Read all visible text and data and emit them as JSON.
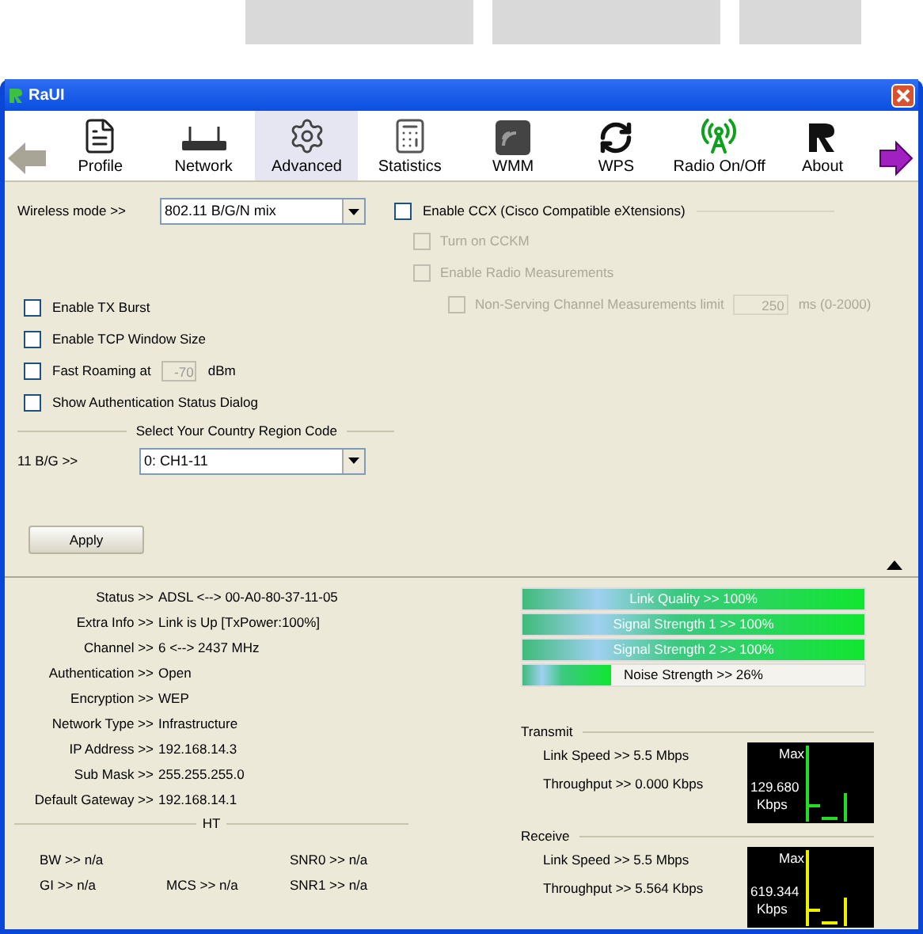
{
  "window": {
    "title": "RaUI"
  },
  "toolbar": [
    {
      "kind": "back",
      "selected": false
    },
    {
      "kind": "profile",
      "label": "Profile",
      "selected": false
    },
    {
      "kind": "network",
      "label": "Network",
      "selected": false
    },
    {
      "kind": "advanced",
      "label": "Advanced",
      "selected": true
    },
    {
      "kind": "statistics",
      "label": "Statistics",
      "selected": false
    },
    {
      "kind": "wmm",
      "label": "WMM",
      "selected": false
    },
    {
      "kind": "wps",
      "label": "WPS",
      "selected": false
    },
    {
      "kind": "radio",
      "label": "Radio On/Off",
      "selected": false
    },
    {
      "kind": "about",
      "label": "About",
      "selected": false
    },
    {
      "kind": "forward",
      "selected": false
    }
  ],
  "wireless_mode": {
    "label": "Wireless mode >>",
    "value": "802.11 B/G/N mix"
  },
  "ccx": {
    "label": "Enable CCX (Cisco Compatible eXtensions)",
    "checked": false
  },
  "ccx_options": [
    {
      "label": "Turn on CCKM",
      "checked": false,
      "disabled": true
    },
    {
      "label": "Enable Radio Measurements",
      "checked": false,
      "disabled": true
    }
  ],
  "non_serving": {
    "label": "Non-Serving Channel Measurements limit",
    "value": "250",
    "unit": "ms (0-2000)",
    "checked": false,
    "disabled": true
  },
  "options": [
    {
      "kind": "check",
      "label": "Enable TX Burst",
      "checked": false
    },
    {
      "kind": "check",
      "label": "Enable TCP Window Size",
      "checked": false
    },
    {
      "kind": "roaming",
      "label": "Fast Roaming at",
      "value": "-70",
      "unit": "dBm",
      "checked": false
    },
    {
      "kind": "check",
      "label": "Show Authentication Status Dialog",
      "checked": false
    }
  ],
  "region": {
    "title": "Select Your Country Region Code",
    "label": "11 B/G >>",
    "value": "0: CH1-11"
  },
  "apply": "Apply",
  "status": [
    {
      "label": "Status >>",
      "value": "ADSL <--> 00-A0-80-37-11-05"
    },
    {
      "label": "Extra Info >>",
      "value": "Link is Up [TxPower:100%]"
    },
    {
      "label": "Channel >>",
      "value": "6 <--> 2437 MHz"
    },
    {
      "label": "Authentication >>",
      "value": "Open"
    },
    {
      "label": "Encryption >>",
      "value": "WEP"
    },
    {
      "label": "Network Type >>",
      "value": "Infrastructure"
    },
    {
      "label": "IP Address >>",
      "value": "192.168.14.3"
    },
    {
      "label": "Sub Mask >>",
      "value": "255.255.255.0"
    },
    {
      "label": "Default Gateway >>",
      "value": "192.168.14.1"
    }
  ],
  "ht": {
    "title": "HT",
    "rows": [
      {
        "left": "BW >> n/a",
        "right": "SNR0 >> n/a"
      },
      {
        "left": "GI >> n/a",
        "middle": "MCS >> n/a",
        "right": "SNR1 >> n/a"
      }
    ]
  },
  "meters": [
    {
      "label": "Link Quality >> 100%",
      "level": 1
    },
    {
      "label": "Signal Strength 1 >> 100%",
      "level": 1
    },
    {
      "label": "Signal Strength 2 >> 100%",
      "level": 1
    },
    {
      "label": "Noise Strength >> 26%",
      "level": 0.26
    }
  ],
  "traffic": [
    {
      "kind": "transmit",
      "title": "Transmit",
      "rows": [
        "Link Speed >> 5.5 Mbps",
        "Throughput >> 0.000 Kbps"
      ],
      "graph": {
        "max": "Max",
        "value": "129.680",
        "unit": "Kbps"
      }
    },
    {
      "kind": "receive",
      "title": "Receive",
      "rows": [
        "Link Speed >> 5.5 Mbps",
        "Throughput >> 5.564 Kbps"
      ],
      "graph": {
        "max": "Max",
        "value": "619.344",
        "unit": "Kbps"
      }
    }
  ]
}
